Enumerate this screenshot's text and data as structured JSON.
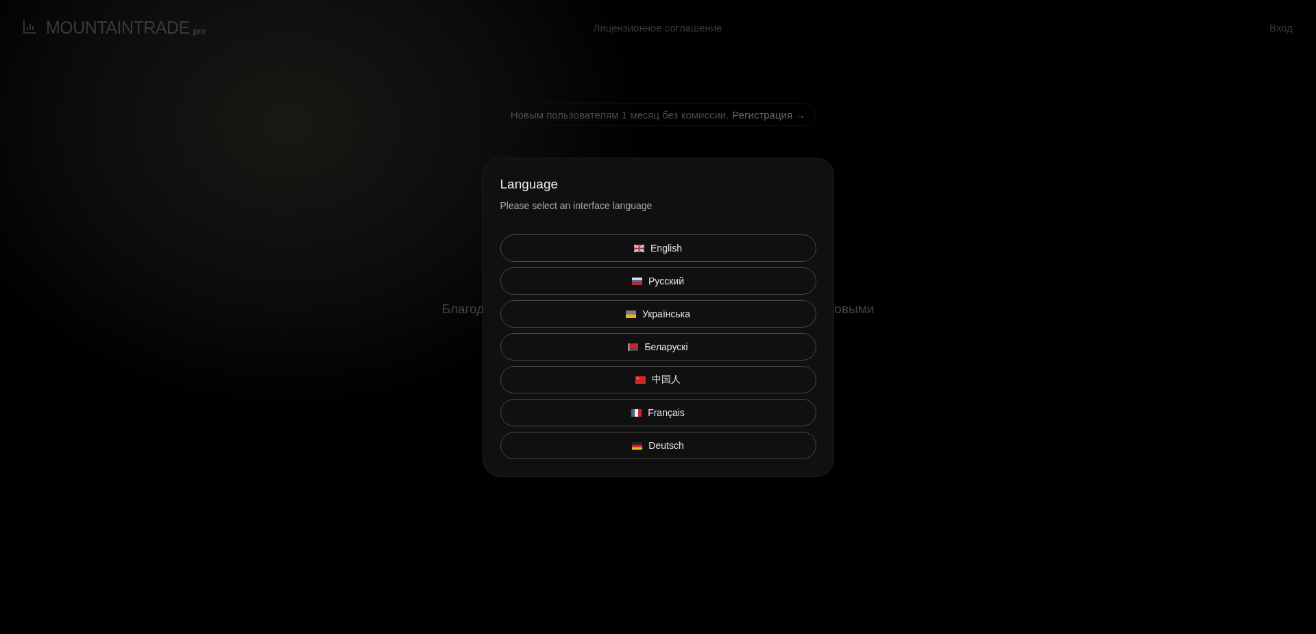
{
  "header": {
    "logo": {
      "name": "MOUNTAINTRADE",
      "suffix": ".pro"
    },
    "nav_link": "Лицензионное соглашение",
    "login": "Вход"
  },
  "banner": {
    "text": "Новым пользователям 1 месяц без комиссии.",
    "link": "Регистрация →"
  },
  "background_text": {
    "left": "Благод",
    "right": "овыми"
  },
  "dialog": {
    "title": "Language",
    "subtitle": "Please select an interface language",
    "languages": [
      {
        "label": "English",
        "kind": "gb"
      },
      {
        "label": "Русский",
        "kind": "ru"
      },
      {
        "label": "Українська",
        "kind": "ua"
      },
      {
        "label": "Беларускі",
        "kind": "by"
      },
      {
        "label": "中国人",
        "kind": "cn"
      },
      {
        "label": "Français",
        "kind": "fr"
      },
      {
        "label": "Deutsch",
        "kind": "de"
      }
    ]
  }
}
